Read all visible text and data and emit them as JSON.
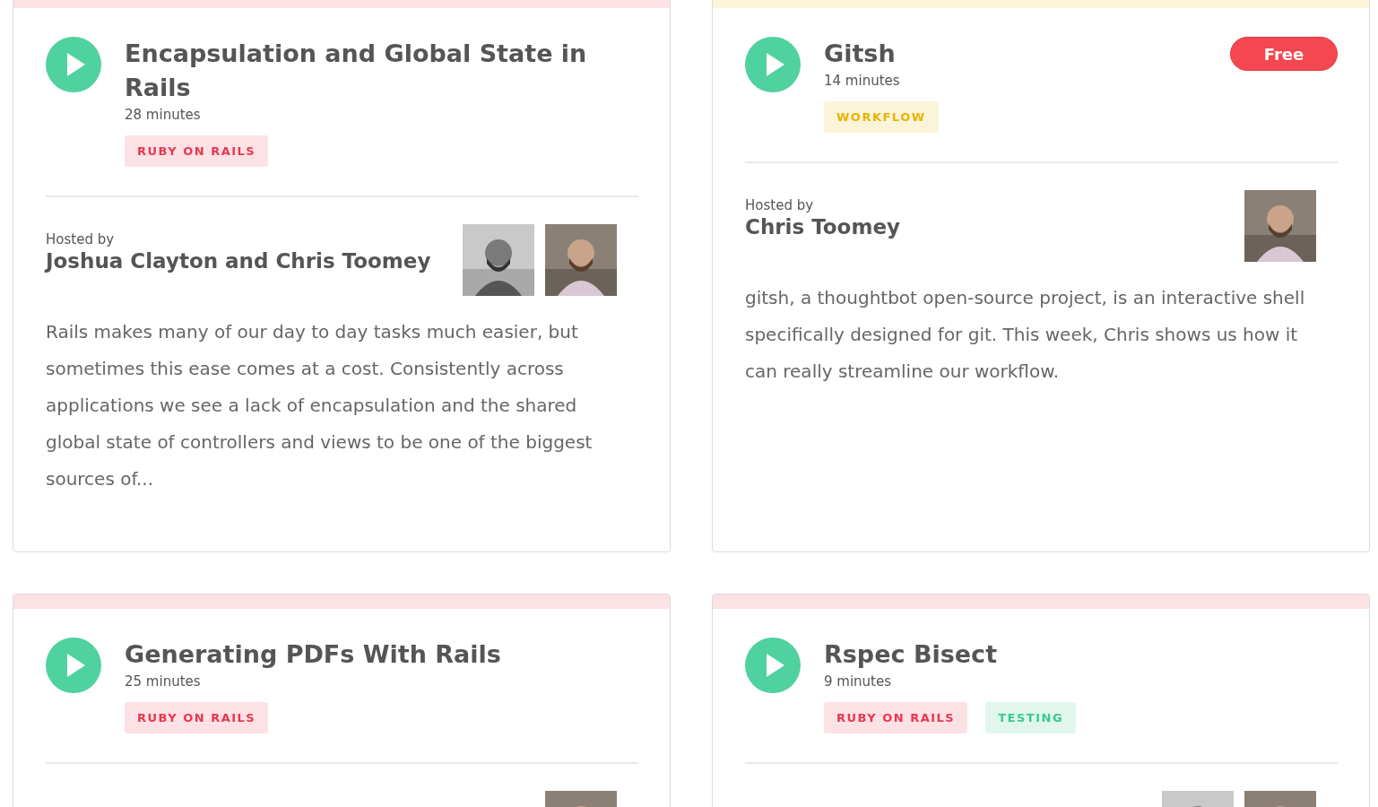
{
  "episodes": [
    {
      "title": "Encapsulation and Global State in Rails",
      "duration": "28 minutes",
      "free": false,
      "tags": [
        {
          "label": "RUBY ON RAILS",
          "color": "#e8384f"
        }
      ],
      "hosted_label": "Hosted by",
      "hosts": "Joshua Clayton and Chris Toomey",
      "avatars": [
        {
          "kind": "picture"
        },
        {
          "kind": "picture"
        }
      ],
      "description": "Rails makes many of our day to day tasks much easier, but sometimes this ease comes at a cost. Consistently across applications we see a lack of encapsulation and the shared global state of controllers and views to be one of the biggest sources of..."
    },
    {
      "title": "Gitsh",
      "duration": "14 minutes",
      "free": true,
      "free_label": "Free",
      "tags": [
        {
          "label": "WORKFLOW",
          "color": "#e8b400"
        }
      ],
      "hosted_label": "Hosted by",
      "hosts": "Chris Toomey",
      "avatars": [
        {
          "kind": "picture"
        }
      ],
      "description": "gitsh, a thoughtbot open-source project, is an interactive shell specifically designed for git. This week, Chris shows us how it can really streamline our workflow."
    },
    {
      "title": "Generating PDFs With Rails",
      "duration": "25 minutes",
      "free": false,
      "tags": [
        {
          "label": "RUBY ON RAILS",
          "color": "#e8384f"
        }
      ],
      "avatars": [
        {
          "kind": "picture"
        }
      ]
    },
    {
      "title": "Rspec Bisect",
      "duration": "9 minutes",
      "free": false,
      "tags": [
        {
          "label": "RUBY ON RAILS",
          "color": "#e8384f"
        },
        {
          "label": "TESTING",
          "color": "#35c990"
        }
      ],
      "avatars": [
        {
          "kind": "picture"
        },
        {
          "kind": "picture"
        }
      ]
    }
  ]
}
